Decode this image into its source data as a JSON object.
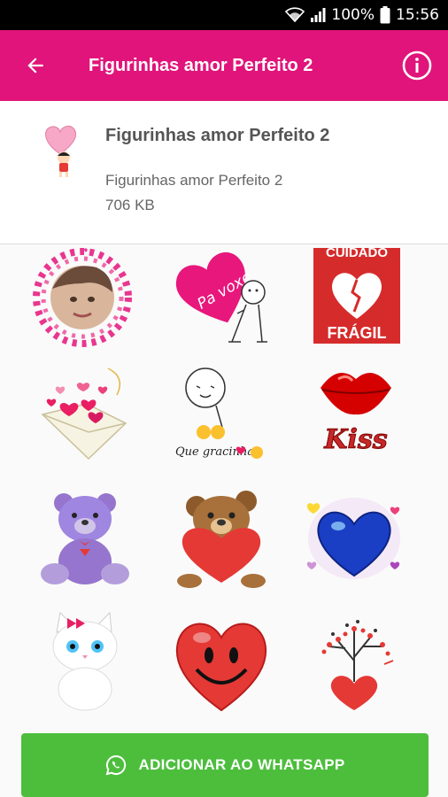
{
  "status": {
    "battery_percent": "100%",
    "time": "15:56"
  },
  "appbar": {
    "title": "Figurinhas amor Perfeito 2"
  },
  "pack": {
    "name": "Figurinhas amor Perfeito 2",
    "publisher": "Figurinhas amor Perfeito 2",
    "size": "706 KB"
  },
  "stickers": [
    {
      "name": "girl-photo-hearts-sticker"
    },
    {
      "name": "pa-voxe-heart-sticker",
      "text": "Pa voxe"
    },
    {
      "name": "cuidado-fragil-sticker",
      "text_top": "CUIDADO",
      "text_bottom": "FRÁGIL"
    },
    {
      "name": "love-letter-hearts-sticker"
    },
    {
      "name": "que-gracinha-sticker",
      "text": "Que gracinha"
    },
    {
      "name": "kiss-lips-sticker",
      "text": "Kiss"
    },
    {
      "name": "purple-teddy-bear-sticker"
    },
    {
      "name": "brown-teddy-bear-heart-sticker"
    },
    {
      "name": "blue-heart-sticker"
    },
    {
      "name": "white-kitten-sticker"
    },
    {
      "name": "smiling-red-heart-sticker"
    },
    {
      "name": "heart-tree-sticker"
    }
  ],
  "cta": {
    "label": "ADICIONAR AO WHATSAPP"
  },
  "colors": {
    "appbar": "#e0147a",
    "cta": "#4cbe3c",
    "statusbar": "#000000"
  }
}
